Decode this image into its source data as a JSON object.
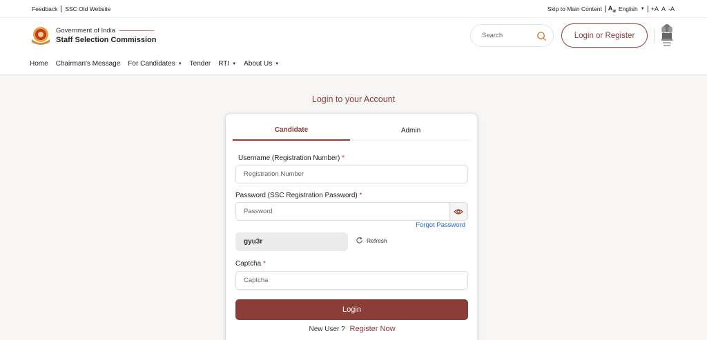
{
  "topbar": {
    "feedback": "Feedback",
    "old_site": "SSC Old Website",
    "skip": "Skip to Main Content",
    "language": "English",
    "font_increase": "+A",
    "font_normal": "A",
    "font_decrease": "-A"
  },
  "header": {
    "gov": "Government of India",
    "org": "Staff Selection Commission",
    "search_placeholder": "Search",
    "login_register": "Login or Register"
  },
  "nav": {
    "items": [
      {
        "label": "Home"
      },
      {
        "label": "Chairman's Message"
      },
      {
        "label": "For Candidates"
      },
      {
        "label": "Tender"
      },
      {
        "label": "RTI"
      },
      {
        "label": "About Us"
      }
    ]
  },
  "main": {
    "title": "Login to your Account",
    "tabs": {
      "candidate": "Candidate",
      "admin": "Admin"
    },
    "username_label": "Username (Registration Number)",
    "username_placeholder": "Registration Number",
    "password_label": "Password (SSC Registration Password)",
    "password_placeholder": "Password",
    "forgot": "Forgot Password",
    "captcha_code": "gyu3r",
    "refresh": "Refresh",
    "captcha_label": "Captcha",
    "captcha_placeholder": "Captcha",
    "required_mark": "*",
    "login": "Login",
    "new_user": "New User ?",
    "register": "Register Now"
  },
  "colors": {
    "brand": "#8b3d38",
    "link": "#2566c4",
    "background": "#f7f6f4"
  }
}
